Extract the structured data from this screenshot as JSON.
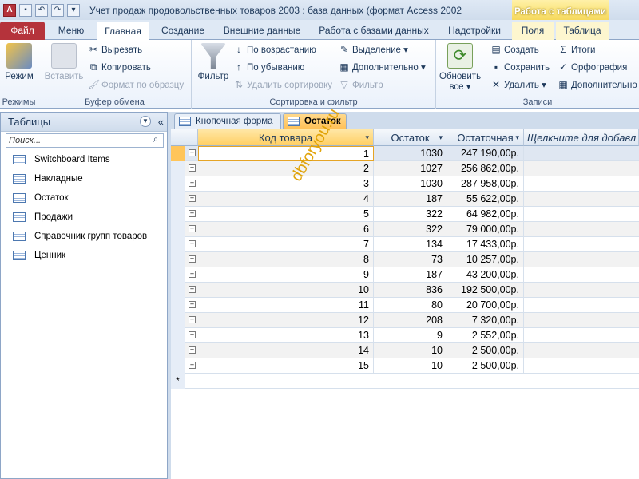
{
  "title": "Учет продаж продовольственных товаров 2003 : база данных (формат Access 2002 ...",
  "context_tab": "Работа с таблицами",
  "ribbon_tabs": [
    "Файл",
    "Меню",
    "Главная",
    "Создание",
    "Внешние данные",
    "Работа с базами данных",
    "Надстройки",
    "Поля",
    "Таблица"
  ],
  "groups": {
    "views": {
      "label": "Режимы",
      "mode": "Режим"
    },
    "clipboard": {
      "label": "Буфер обмена",
      "paste": "Вставить",
      "cut": "Вырезать",
      "copy": "Копировать",
      "format": "Формат по образцу"
    },
    "sort": {
      "label": "Сортировка и фильтр",
      "filter": "Фильтр",
      "asc": "По возрастанию",
      "desc": "По убыванию",
      "remove": "Удалить сортировку",
      "selection": "Выделение",
      "advanced": "Дополнительно",
      "toggle": "Фильтр"
    },
    "records": {
      "label": "Записи",
      "refresh": "Обновить все",
      "new": "Создать",
      "save": "Сохранить",
      "delete": "Удалить",
      "totals": "Итоги",
      "spell": "Орфография",
      "more": "Дополнительно"
    }
  },
  "nav": {
    "header": "Таблицы",
    "search_placeholder": "Поиск...",
    "items": [
      "Switchboard Items",
      "Накладные",
      "Остаток",
      "Продажи",
      "Справочник групп товаров",
      "Ценник"
    ]
  },
  "doc_tabs": [
    "Кнопочная форма",
    "Остаток"
  ],
  "table": {
    "columns": [
      "Код товара",
      "Остаток",
      "Остаточная",
      "Щелкните для добавл"
    ],
    "rows": [
      [
        "1",
        "1030",
        "247 190,00р."
      ],
      [
        "2",
        "1027",
        "256 862,00р."
      ],
      [
        "3",
        "1030",
        "287 958,00р."
      ],
      [
        "4",
        "187",
        "55 622,00р."
      ],
      [
        "5",
        "322",
        "64 982,00р."
      ],
      [
        "6",
        "322",
        "79 000,00р."
      ],
      [
        "7",
        "134",
        "17 433,00р."
      ],
      [
        "8",
        "73",
        "10 257,00р."
      ],
      [
        "9",
        "187",
        "43 200,00р."
      ],
      [
        "10",
        "836",
        "192 500,00р."
      ],
      [
        "11",
        "80",
        "20 700,00р."
      ],
      [
        "12",
        "208",
        "7 320,00р."
      ],
      [
        "13",
        "9",
        "2 552,00р."
      ],
      [
        "14",
        "10",
        "2 500,00р."
      ],
      [
        "15",
        "10",
        "2 500,00р."
      ]
    ],
    "new_row_marker": "*"
  },
  "watermark": "dbforyou.ru"
}
